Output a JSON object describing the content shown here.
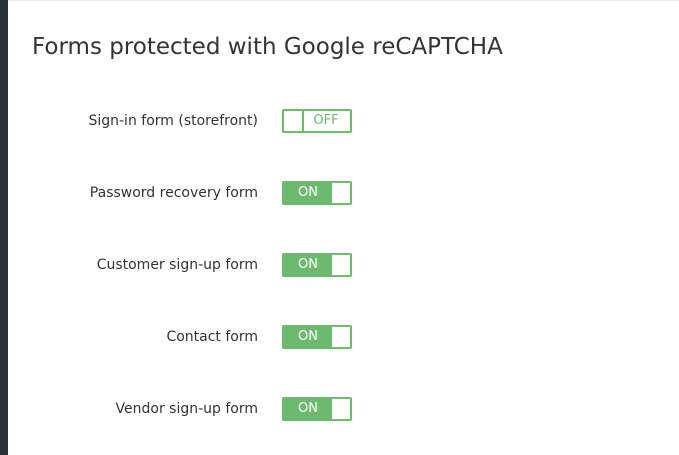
{
  "section": {
    "title": "Forms protected with Google reCAPTCHA"
  },
  "forms": [
    {
      "label": "Sign-in form (storefront)",
      "state": "OFF"
    },
    {
      "label": "Password recovery form",
      "state": "ON"
    },
    {
      "label": "Customer sign-up form",
      "state": "ON"
    },
    {
      "label": "Contact form",
      "state": "ON"
    },
    {
      "label": "Vendor sign-up form",
      "state": "ON"
    }
  ],
  "colors": {
    "toggle_accent": "#6dba6f",
    "sidebar": "#2b3035"
  }
}
